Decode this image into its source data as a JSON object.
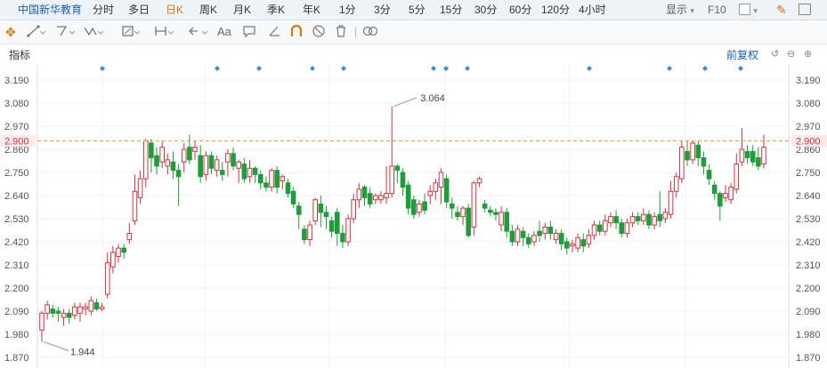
{
  "topbar": {
    "title": "中国新华教育",
    "periods": [
      "分时",
      "多日",
      "日K",
      "周K",
      "月K",
      "季K",
      "年K",
      "1分",
      "3分",
      "5分",
      "15分",
      "30分",
      "60分",
      "120分",
      "4小时"
    ],
    "active_period": "日K",
    "display_label": "显示",
    "f10_label": "F10"
  },
  "toolbar": {
    "aa_label": "Aa"
  },
  "chart": {
    "indicator_label": "指标",
    "adjust_label": "前复权",
    "y_ticks": [
      "3.190",
      "3.080",
      "2.970",
      "2.860",
      "2.750",
      "2.640",
      "2.530",
      "2.420",
      "2.310",
      "2.200",
      "2.090",
      "1.980",
      "1.870"
    ],
    "current_price": "2.900",
    "max_label": "3.064",
    "min_label": "1.944",
    "colors": {
      "up": "#d6313f",
      "down": "#1e9e3a",
      "ref": "#f0a030",
      "accent": "#1a5fb4"
    }
  },
  "chart_data": {
    "type": "candlestick",
    "ylim": [
      1.85,
      3.23
    ],
    "y_ticks": [
      3.19,
      3.08,
      2.97,
      2.86,
      2.75,
      2.64,
      2.53,
      2.42,
      2.31,
      2.2,
      2.09,
      1.98,
      1.87
    ],
    "reference_price": 2.9,
    "high_marker": 3.064,
    "low_marker": 1.944,
    "candles": [
      [
        2.0,
        2.08,
        1.944,
        2.09
      ],
      [
        2.08,
        2.12,
        2.05,
        2.14
      ],
      [
        2.1,
        2.08,
        2.06,
        2.12
      ],
      [
        2.09,
        2.08,
        2.04,
        2.11
      ],
      [
        2.06,
        2.08,
        2.02,
        2.1
      ],
      [
        2.08,
        2.06,
        2.03,
        2.1
      ],
      [
        2.07,
        2.11,
        2.05,
        2.13
      ],
      [
        2.08,
        2.11,
        2.04,
        2.13
      ],
      [
        2.1,
        2.11,
        2.07,
        2.13
      ],
      [
        2.09,
        2.14,
        2.07,
        2.16
      ],
      [
        2.13,
        2.1,
        2.09,
        2.15
      ],
      [
        2.1,
        2.11,
        2.09,
        2.13
      ],
      [
        2.17,
        2.32,
        2.15,
        2.37
      ],
      [
        2.3,
        2.37,
        2.27,
        2.4
      ],
      [
        2.35,
        2.39,
        2.32,
        2.41
      ],
      [
        2.39,
        2.37,
        2.34,
        2.41
      ],
      [
        2.43,
        2.46,
        2.41,
        2.51
      ],
      [
        2.52,
        2.66,
        2.5,
        2.74
      ],
      [
        2.63,
        2.72,
        2.6,
        2.76
      ],
      [
        2.72,
        2.9,
        2.68,
        2.91
      ],
      [
        2.89,
        2.82,
        2.75,
        2.91
      ],
      [
        2.83,
        2.78,
        2.74,
        2.87
      ],
      [
        2.8,
        2.87,
        2.77,
        2.9
      ],
      [
        2.78,
        2.81,
        2.74,
        2.84
      ],
      [
        2.8,
        2.76,
        2.72,
        2.85
      ],
      [
        2.76,
        2.73,
        2.59,
        2.79
      ],
      [
        2.8,
        2.86,
        2.75,
        2.89
      ],
      [
        2.87,
        2.81,
        2.79,
        2.93
      ],
      [
        2.85,
        2.87,
        2.81,
        2.9
      ],
      [
        2.83,
        2.73,
        2.7,
        2.88
      ],
      [
        2.74,
        2.83,
        2.71,
        2.85
      ],
      [
        2.83,
        2.77,
        2.74,
        2.85
      ],
      [
        2.76,
        2.81,
        2.73,
        2.83
      ],
      [
        2.76,
        2.74,
        2.71,
        2.8
      ],
      [
        2.8,
        2.84,
        2.73,
        2.86
      ],
      [
        2.84,
        2.78,
        2.76,
        2.87
      ],
      [
        2.77,
        2.8,
        2.7,
        2.81
      ],
      [
        2.79,
        2.72,
        2.7,
        2.82
      ],
      [
        2.73,
        2.77,
        2.7,
        2.81
      ],
      [
        2.77,
        2.74,
        2.7,
        2.78
      ],
      [
        2.74,
        2.7,
        2.67,
        2.76
      ],
      [
        2.7,
        2.68,
        2.66,
        2.73
      ],
      [
        2.68,
        2.76,
        2.66,
        2.77
      ],
      [
        2.76,
        2.68,
        2.65,
        2.78
      ],
      [
        2.71,
        2.73,
        2.67,
        2.74
      ],
      [
        2.7,
        2.65,
        2.63,
        2.72
      ],
      [
        2.66,
        2.6,
        2.58,
        2.68
      ],
      [
        2.59,
        2.55,
        2.48,
        2.61
      ],
      [
        2.48,
        2.43,
        2.41,
        2.5
      ],
      [
        2.43,
        2.5,
        2.4,
        2.52
      ],
      [
        2.52,
        2.62,
        2.5,
        2.63
      ],
      [
        2.6,
        2.56,
        2.49,
        2.64
      ],
      [
        2.56,
        2.54,
        2.48,
        2.59
      ],
      [
        2.52,
        2.47,
        2.44,
        2.54
      ],
      [
        2.56,
        2.46,
        2.4,
        2.58
      ],
      [
        2.46,
        2.42,
        2.39,
        2.5
      ],
      [
        2.42,
        2.53,
        2.4,
        2.55
      ],
      [
        2.53,
        2.62,
        2.51,
        2.65
      ],
      [
        2.62,
        2.67,
        2.58,
        2.7
      ],
      [
        2.68,
        2.63,
        2.59,
        2.69
      ],
      [
        2.65,
        2.6,
        2.58,
        2.68
      ],
      [
        2.62,
        2.64,
        2.6,
        2.65
      ],
      [
        2.62,
        2.64,
        2.6,
        2.66
      ],
      [
        2.63,
        2.65,
        2.6,
        2.78
      ],
      [
        2.65,
        2.78,
        2.63,
        3.064
      ],
      [
        2.78,
        2.76,
        2.7,
        2.79
      ],
      [
        2.75,
        2.68,
        2.64,
        2.77
      ],
      [
        2.69,
        2.58,
        2.55,
        2.71
      ],
      [
        2.62,
        2.55,
        2.53,
        2.64
      ],
      [
        2.56,
        2.6,
        2.54,
        2.62
      ],
      [
        2.61,
        2.57,
        2.55,
        2.65
      ],
      [
        2.64,
        2.66,
        2.6,
        2.69
      ],
      [
        2.66,
        2.7,
        2.62,
        2.72
      ],
      [
        2.68,
        2.75,
        2.6,
        2.77
      ],
      [
        2.72,
        2.61,
        2.58,
        2.74
      ],
      [
        2.6,
        2.58,
        2.53,
        2.63
      ],
      [
        2.56,
        2.54,
        2.52,
        2.59
      ],
      [
        2.54,
        2.58,
        2.5,
        2.59
      ],
      [
        2.58,
        2.45,
        2.44,
        2.6
      ],
      [
        2.49,
        2.7,
        2.45,
        2.71
      ],
      [
        2.7,
        2.72,
        2.68,
        2.73
      ],
      [
        2.6,
        2.58,
        2.56,
        2.62
      ],
      [
        2.57,
        2.56,
        2.54,
        2.59
      ],
      [
        2.56,
        2.55,
        2.52,
        2.58
      ],
      [
        2.5,
        2.56,
        2.47,
        2.59
      ],
      [
        2.56,
        2.47,
        2.44,
        2.58
      ],
      [
        2.47,
        2.42,
        2.4,
        2.5
      ],
      [
        2.42,
        2.48,
        2.4,
        2.5
      ],
      [
        2.47,
        2.44,
        2.4,
        2.49
      ],
      [
        2.44,
        2.41,
        2.39,
        2.46
      ],
      [
        2.42,
        2.45,
        2.4,
        2.47
      ],
      [
        2.47,
        2.45,
        2.42,
        2.52
      ],
      [
        2.46,
        2.49,
        2.43,
        2.51
      ],
      [
        2.49,
        2.46,
        2.43,
        2.52
      ],
      [
        2.43,
        2.46,
        2.41,
        2.48
      ],
      [
        2.46,
        2.41,
        2.38,
        2.48
      ],
      [
        2.42,
        2.39,
        2.36,
        2.44
      ],
      [
        2.4,
        2.41,
        2.37,
        2.43
      ],
      [
        2.39,
        2.44,
        2.37,
        2.46
      ],
      [
        2.43,
        2.4,
        2.37,
        2.46
      ],
      [
        2.41,
        2.45,
        2.39,
        2.48
      ],
      [
        2.45,
        2.5,
        2.43,
        2.52
      ],
      [
        2.5,
        2.47,
        2.45,
        2.52
      ],
      [
        2.47,
        2.52,
        2.45,
        2.55
      ],
      [
        2.51,
        2.54,
        2.49,
        2.56
      ],
      [
        2.54,
        2.51,
        2.48,
        2.57
      ],
      [
        2.51,
        2.46,
        2.44,
        2.53
      ],
      [
        2.46,
        2.51,
        2.44,
        2.53
      ],
      [
        2.51,
        2.54,
        2.49,
        2.56
      ],
      [
        2.54,
        2.52,
        2.5,
        2.56
      ],
      [
        2.52,
        2.55,
        2.5,
        2.58
      ],
      [
        2.55,
        2.5,
        2.48,
        2.57
      ],
      [
        2.5,
        2.54,
        2.48,
        2.56
      ],
      [
        2.55,
        2.52,
        2.49,
        2.66
      ],
      [
        2.53,
        2.56,
        2.51,
        2.58
      ],
      [
        2.55,
        2.66,
        2.53,
        2.71
      ],
      [
        2.66,
        2.73,
        2.63,
        2.75
      ],
      [
        2.72,
        2.87,
        2.7,
        2.9
      ],
      [
        2.85,
        2.81,
        2.78,
        2.9
      ],
      [
        2.81,
        2.89,
        2.79,
        2.9
      ],
      [
        2.88,
        2.82,
        2.78,
        2.9
      ],
      [
        2.82,
        2.78,
        2.74,
        2.85
      ],
      [
        2.76,
        2.72,
        2.69,
        2.79
      ],
      [
        2.69,
        2.65,
        2.62,
        2.71
      ],
      [
        2.65,
        2.59,
        2.52,
        2.66
      ],
      [
        2.63,
        2.65,
        2.61,
        2.69
      ],
      [
        2.62,
        2.68,
        2.6,
        2.7
      ],
      [
        2.67,
        2.79,
        2.65,
        2.84
      ],
      [
        2.8,
        2.86,
        2.78,
        2.96
      ],
      [
        2.85,
        2.82,
        2.79,
        2.88
      ],
      [
        2.85,
        2.8,
        2.78,
        2.88
      ],
      [
        2.82,
        2.78,
        2.76,
        2.87
      ],
      [
        2.79,
        2.87,
        2.77,
        2.93
      ]
    ]
  }
}
